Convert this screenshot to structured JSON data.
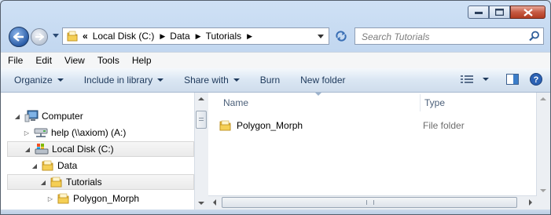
{
  "window": {
    "minimize_label": "",
    "maximize_label": "",
    "close_label": ""
  },
  "address_bar": {
    "overflow": "«",
    "segments": [
      "Local Disk (C:)",
      "Data",
      "Tutorials"
    ]
  },
  "search": {
    "placeholder": "Search Tutorials"
  },
  "menu": {
    "items": [
      "File",
      "Edit",
      "View",
      "Tools",
      "Help"
    ]
  },
  "command_bar": {
    "organize": "Organize",
    "include_in_library": "Include in library",
    "share_with": "Share with",
    "burn": "Burn",
    "new_folder": "New folder"
  },
  "nav_tree": {
    "items": [
      {
        "label": "Computer",
        "icon": "computer-icon"
      },
      {
        "label": "help (\\\\axiom) (A:)",
        "icon": "network-drive-icon"
      },
      {
        "label": "Local Disk (C:)",
        "icon": "local-disk-icon"
      },
      {
        "label": "Data",
        "icon": "folder-icon"
      },
      {
        "label": "Tutorials",
        "icon": "folder-icon"
      },
      {
        "label": "Polygon_Morph",
        "icon": "folder-icon"
      }
    ]
  },
  "file_list": {
    "columns": [
      "Name",
      "Type"
    ],
    "rows": [
      {
        "name": "Polygon_Morph",
        "type": "File folder",
        "icon": "folder-icon"
      }
    ]
  },
  "colors": {
    "accent": "#2c5ea8",
    "chrome": "#c7d9ef",
    "close": "#c65a42"
  }
}
